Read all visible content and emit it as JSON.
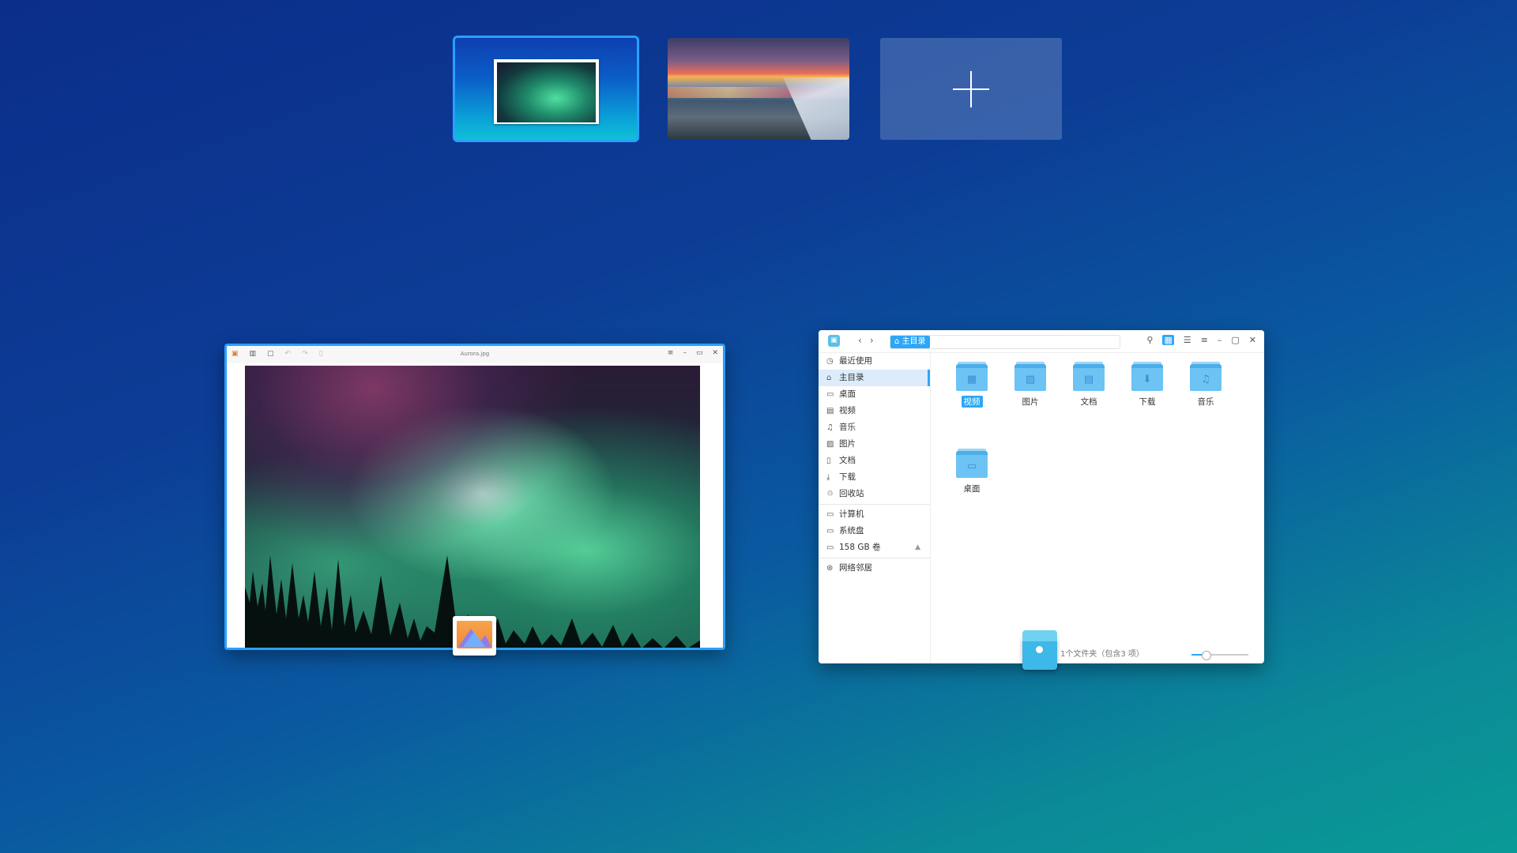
{
  "workspaces": {
    "items": [
      {
        "name": "workspace-1",
        "active": true
      },
      {
        "name": "workspace-2",
        "active": false
      }
    ],
    "add_symbol": "+"
  },
  "image_viewer": {
    "title": "Aurora.jpg",
    "toolbar_icons": [
      "logo-icon",
      "panel-icon",
      "fit-icon",
      "rotate-left-icon",
      "rotate-right-icon",
      "delete-icon"
    ],
    "window_buttons": [
      "menu-icon",
      "minimize-icon",
      "maximize-icon",
      "close-icon"
    ]
  },
  "file_manager": {
    "breadcrumb": "主目录",
    "nav_back": "‹",
    "nav_forward": "›",
    "sidebar": {
      "group1": [
        {
          "label": "最近使用",
          "icon": "clock-icon",
          "glyph": "◷"
        },
        {
          "label": "主目录",
          "icon": "home-icon",
          "glyph": "⌂",
          "active": true
        },
        {
          "label": "桌面",
          "icon": "desktop-icon",
          "glyph": "▭"
        },
        {
          "label": "视频",
          "icon": "video-icon",
          "glyph": "▤"
        },
        {
          "label": "音乐",
          "icon": "music-icon",
          "glyph": "♫"
        },
        {
          "label": "图片",
          "icon": "image-icon",
          "glyph": "▨"
        },
        {
          "label": "文档",
          "icon": "document-icon",
          "glyph": "▯"
        },
        {
          "label": "下载",
          "icon": "download-icon",
          "glyph": "⤓"
        },
        {
          "label": "回收站",
          "icon": "trash-icon",
          "glyph": "♲"
        }
      ],
      "group2": [
        {
          "label": "计算机",
          "icon": "computer-icon",
          "glyph": "▭"
        },
        {
          "label": "系统盘",
          "icon": "disk-icon",
          "glyph": "▭"
        },
        {
          "label": "158 GB 卷",
          "icon": "disk-icon",
          "glyph": "▭",
          "eject": "▲"
        }
      ],
      "group3": [
        {
          "label": "网络邻居",
          "icon": "network-icon",
          "glyph": "⊛"
        }
      ]
    },
    "folders": [
      {
        "label": "视频",
        "glyph": "▦",
        "selected": true
      },
      {
        "label": "图片",
        "glyph": "▨",
        "selected": false
      },
      {
        "label": "文档",
        "glyph": "▤",
        "selected": false
      },
      {
        "label": "下载",
        "glyph": "⬇",
        "selected": false
      },
      {
        "label": "音乐",
        "glyph": "♫",
        "selected": false
      },
      {
        "label": "桌面",
        "glyph": "▭",
        "selected": false
      }
    ],
    "status": "1个文件夹（包含3 项）",
    "zoom_fraction": 0.25,
    "accent_color": "#2ca7f8"
  }
}
